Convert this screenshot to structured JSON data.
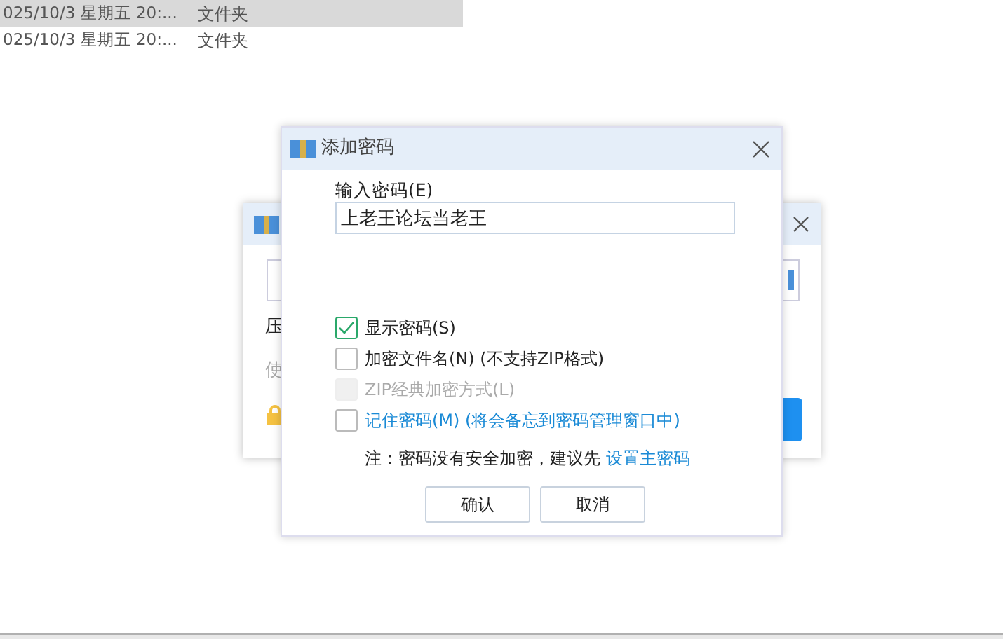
{
  "file_rows": [
    {
      "date": "025/10/3 星期五 20:...",
      "type": "文件夹",
      "selected": true
    },
    {
      "date": "025/10/3 星期五 20:...",
      "type": "文件夹",
      "selected": false
    }
  ],
  "back_dialog": {
    "row_1": "压",
    "row_2": "使"
  },
  "dialog": {
    "title": "添加密码",
    "password_label": "输入密码(E)",
    "password_value": "上老王论坛当老王",
    "options": [
      {
        "label": "显示密码(S)",
        "checked": true,
        "disabled": false,
        "link": false
      },
      {
        "label": "加密文件名(N) (不支持ZIP格式)",
        "checked": false,
        "disabled": false,
        "link": false
      },
      {
        "label": "ZIP经典加密方式(L)",
        "checked": false,
        "disabled": true,
        "link": false
      },
      {
        "label": "记住密码(M) (将会备忘到密码管理窗口中)",
        "checked": false,
        "disabled": false,
        "link": true
      }
    ],
    "note": "注：密码没有安全加密，建议先",
    "note_link": "设置主密码",
    "buttons": [
      "确认",
      "取消"
    ]
  }
}
